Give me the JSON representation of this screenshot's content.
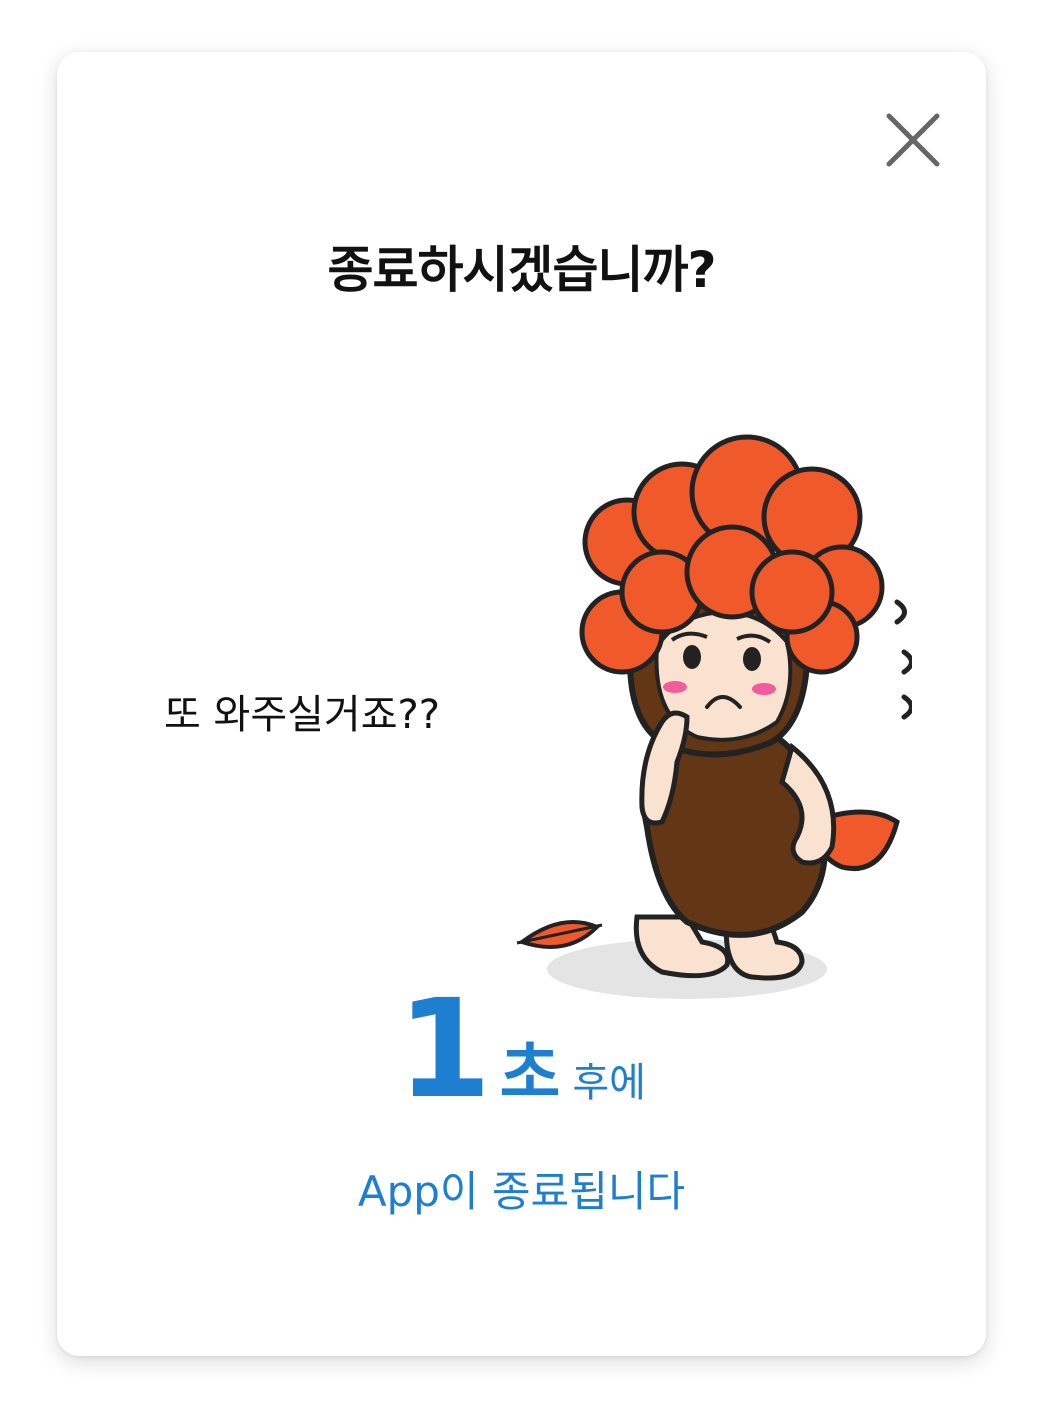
{
  "dialog": {
    "title": "종료하시겠습니까?",
    "close_icon": "close-icon",
    "speech_text": "또 와주실거죠??",
    "mascot_icon": "worried-mascot-illustration",
    "countdown": {
      "number": "1",
      "unit": "초",
      "after": "후에"
    },
    "closing_message": "App이 종료됩니다"
  },
  "colors": {
    "accent": "#1e7fd0",
    "hair": "#f05a2b",
    "body": "#633616",
    "skin": "#f9e3d0",
    "cheek": "#f25c9a",
    "shadow": "#e4e4e4"
  }
}
